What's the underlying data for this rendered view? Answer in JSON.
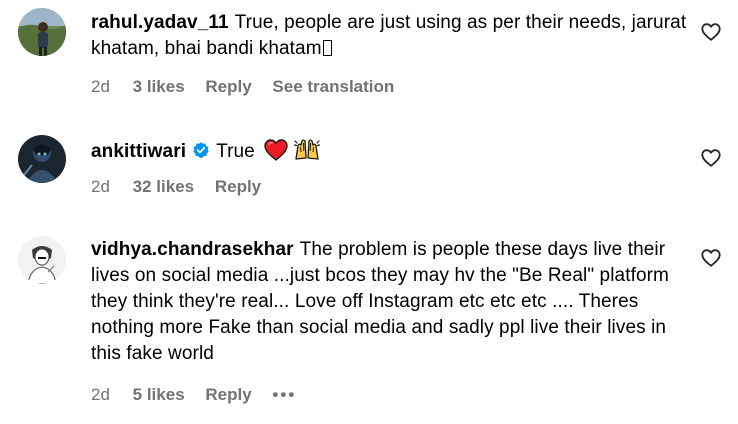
{
  "comments": [
    {
      "username": "rahul.yadav_11",
      "text": "True, people are just using as per their needs, jarurat khatam, bhai bandi khatam",
      "trailing_glyph": "▯",
      "time": "2d",
      "likes": "3 likes",
      "reply": "Reply",
      "translation": "See translation",
      "avatar": "outdoor-person-avatar"
    },
    {
      "username": "ankittiwari",
      "verified": true,
      "text": "True",
      "emojis": [
        "red-heart-emoji",
        "raising-hands-emoji"
      ],
      "time": "2d",
      "likes": "32 likes",
      "reply": "Reply",
      "avatar": "dark-hooded-avatar"
    },
    {
      "username": "vidhya.chandrasekhar",
      "text": "The problem is people these days live their lives on social media ...just bcos they may hv the \"Be Real\" platform they think they're real... Love off Instagram etc etc etc .... Theres nothing more Fake than social media and sadly ppl live their lives in this fake world",
      "time": "2d",
      "likes": "5 likes",
      "reply": "Reply",
      "more": "•••",
      "avatar": "sketch-avatar"
    }
  ],
  "icons": {
    "like": "heart-outline-icon",
    "verified": "verified-badge-icon"
  },
  "colors": {
    "meta_text": "#737373",
    "verified_blue": "#0095F6",
    "heart_red": "#ED1C24"
  }
}
